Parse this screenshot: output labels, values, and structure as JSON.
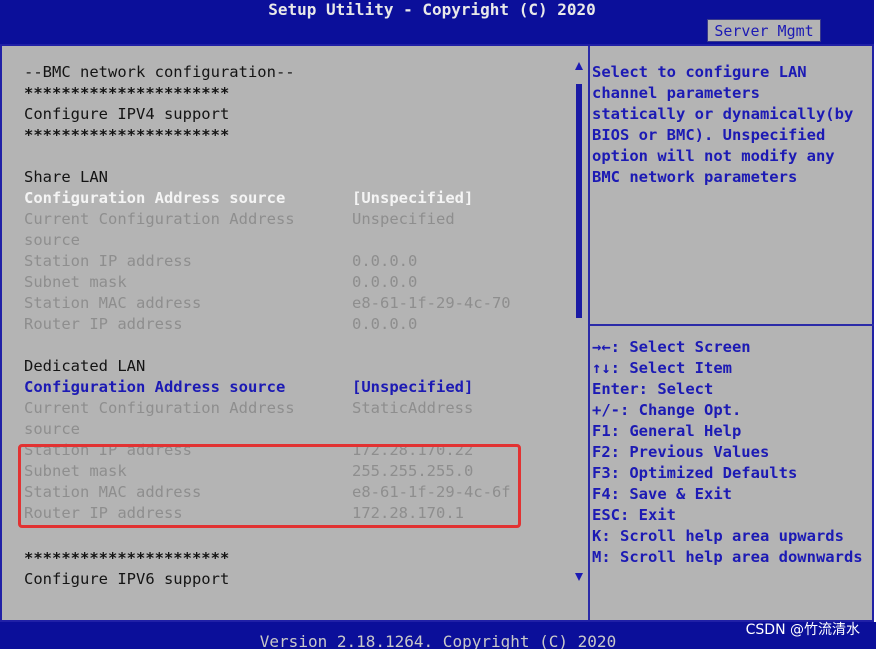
{
  "header": {
    "title": "Setup Utility - Copyright (C) 2020",
    "active_tab": "Server Mgmt"
  },
  "main": {
    "section_title": "--BMC network configuration--",
    "stars": "**********************",
    "ipv4_title": "Configure IPV4 support",
    "share_lan": {
      "heading": "Share LAN",
      "config_source_label": "Configuration Address source",
      "config_source_value": "[Unspecified]",
      "current_config_label_1": "Current Configuration Address",
      "current_config_label_2": "source",
      "current_config_value": "Unspecified",
      "station_ip_label": "Station IP address",
      "station_ip_value": "0.0.0.0",
      "subnet_label": "Subnet mask",
      "subnet_value": "0.0.0.0",
      "mac_label": "Station MAC address",
      "mac_value": "e8-61-1f-29-4c-70",
      "router_label": "Router IP address",
      "router_value": "0.0.0.0"
    },
    "dedicated_lan": {
      "heading": "Dedicated LAN",
      "config_source_label": "Configuration Address source",
      "config_source_value": "[Unspecified]",
      "current_config_label_1": "Current Configuration Address",
      "current_config_label_2": "source",
      "current_config_value": "StaticAddress",
      "station_ip_label": "Station IP address",
      "station_ip_value": "172.28.170.22",
      "subnet_label": "Subnet mask",
      "subnet_value": "255.255.255.0",
      "mac_label": "Station MAC address",
      "mac_value": "e8-61-1f-29-4c-6f",
      "router_label": "Router IP address",
      "router_value": "172.28.170.1"
    },
    "ipv6_title": "Configure IPV6 support"
  },
  "help": {
    "text": "Select to configure LAN channel parameters statically or dynamically(by BIOS or BMC). Unspecified option will not modify any BMC network parameters"
  },
  "keys": [
    "→←: Select Screen",
    "↑↓: Select Item",
    "Enter: Select",
    "+/-: Change Opt.",
    "F1: General Help",
    "F2: Previous Values",
    "F3: Optimized Defaults",
    "F4: Save & Exit",
    "ESC: Exit",
    "K: Scroll help area upwards",
    "M: Scroll help area downwards"
  ],
  "footer": {
    "text": "Version 2.18.1264. Copyright (C) 2020"
  },
  "watermark": "CSDN @竹流清水",
  "colors": {
    "bios_blue": "#0b0f9a",
    "panel_gray": "#b4b4b4",
    "item_blue": "#1c1ab4",
    "highlight_red": "#e23232"
  }
}
